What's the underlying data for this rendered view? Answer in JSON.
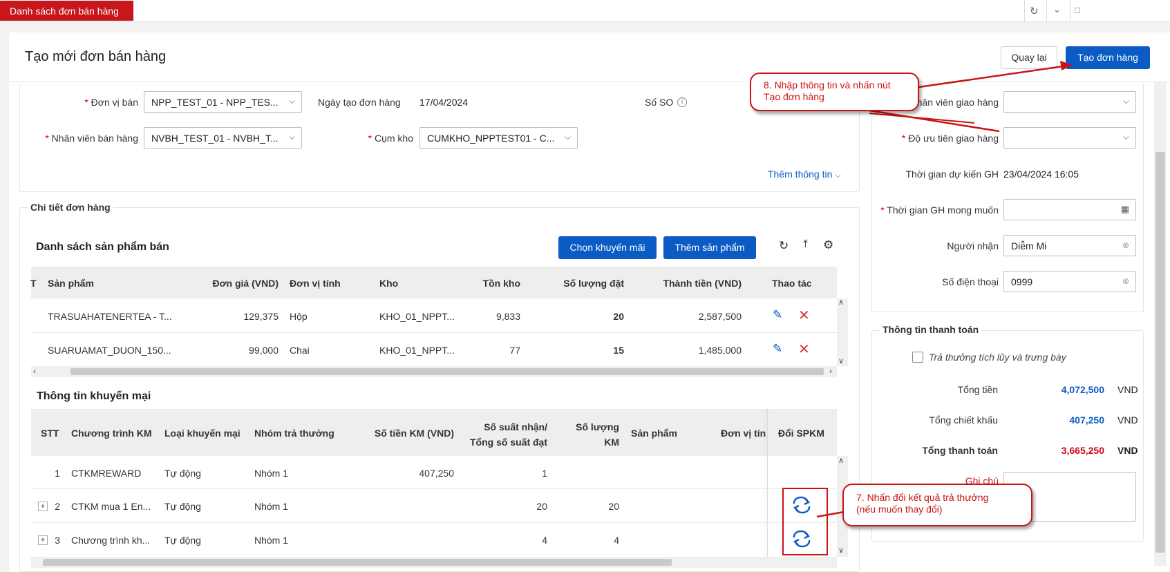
{
  "app": {
    "active_tab": "Danh sách đơn bán hàng"
  },
  "header": {
    "title": "Tạo mới đơn bán hàng",
    "back_label": "Quay lại",
    "create_label": "Tạo đơn hàng"
  },
  "form": {
    "don_vi_ban": {
      "label": "Đơn vị bán",
      "value": "NPP_TEST_01 - NPP_TES..."
    },
    "ngay_tao": {
      "label": "Ngày tạo đơn hàng",
      "value": "17/04/2024"
    },
    "so_so": {
      "label": "Số SO"
    },
    "nhan_vien_ban": {
      "label": "Nhân viên bán hàng",
      "value": "NVBH_TEST_01 - NVBH_T..."
    },
    "cum_kho": {
      "label": "Cụm kho",
      "value": "CUMKHO_NPPTEST01 - C..."
    },
    "them_thong_tin": "Thêm thông tin",
    "req_mark": "*"
  },
  "right_panel": {
    "nv_giao_hang_label": "hân viên giao hàng",
    "do_uu_tien_label": "Độ ưu tiên giao hàng",
    "thoi_gian_du_kien_label": "Thời gian dự kiến GH",
    "thoi_gian_du_kien_value": "23/04/2024 16:05",
    "thoi_gian_mong_muon_label": "Thời gian GH mong muốn",
    "nguoi_nhan_label": "Người nhận",
    "nguoi_nhan_value": "Diễm Mi",
    "sdt_label": "Số điện thoại",
    "sdt_value": "0999"
  },
  "payment": {
    "title": "Thông tin thanh toán",
    "checkbox_label": "Trả thưởng tích lũy và trưng bày",
    "tong_tien_label": "Tổng tiền",
    "tong_tien_value": "4,072,500",
    "tong_ck_label": "Tổng chiết khấu",
    "tong_ck_value": "407,250",
    "tong_tt_label": "Tổng thanh toán",
    "tong_tt_value": "3,665,250",
    "currency": "VND",
    "ghi_chu_label": "Ghi chú"
  },
  "order_detail": {
    "section_title": "Chi tiết đơn hàng",
    "list_title": "Danh sách sản phẩm bán",
    "btn_km": "Chọn khuyến mãi",
    "btn_add": "Thêm sản phẩm",
    "columns": {
      "stt": "T",
      "san_pham": "Sản phẩm",
      "don_gia": "Đơn giá (VND)",
      "dvt": "Đơn vị tính",
      "kho": "Kho",
      "ton_kho": "Tồn kho",
      "sl_dat": "Số lượng đặt",
      "thanh_tien": "Thành tiền (VND)",
      "thao_tac": "Thao tác"
    },
    "rows": [
      {
        "san_pham": "TRASUAHATENERTEA - T...",
        "don_gia": "129,375",
        "dvt": "Hộp",
        "kho": "KHO_01_NPPT...",
        "ton_kho": "9,833",
        "sl_dat": "20",
        "thanh_tien": "2,587,500"
      },
      {
        "san_pham": "SUARUAMAT_DUON_150...",
        "don_gia": "99,000",
        "dvt": "Chai",
        "kho": "KHO_01_NPPT...",
        "ton_kho": "77",
        "sl_dat": "15",
        "thanh_tien": "1,485,000"
      }
    ]
  },
  "promotion": {
    "title": "Thông tin khuyến mại",
    "columns": {
      "stt": "STT",
      "ctkm": "Chương trình KM",
      "loai": "Loại khuyến mại",
      "nhom": "Nhóm trả thưởng",
      "so_tien": "Số tiền KM (VND)",
      "so_suat_1": "Số suất nhận/",
      "so_suat_2": "Tổng số suất đạt",
      "sl_km_1": "Số lượng",
      "sl_km_2": "KM",
      "san_pham": "Sản phẩm",
      "dvt": "Đơn vị tín",
      "doi": "Đổi SPKM"
    },
    "rows": [
      {
        "stt": "1",
        "ctkm": "CTKMREWARD",
        "loai": "Tự động",
        "nhom": "Nhóm 1",
        "so_tien": "407,250",
        "so_suat": "1",
        "sl_km": ""
      },
      {
        "stt": "2",
        "ctkm": "CTKM mua 1 En...",
        "loai": "Tự động",
        "nhom": "Nhóm 1",
        "so_tien": "",
        "so_suat": "20",
        "sl_km": "20"
      },
      {
        "stt": "3",
        "ctkm": "Chương trình kh...",
        "loai": "Tự động",
        "nhom": "Nhóm 1",
        "so_tien": "",
        "so_suat": "4",
        "sl_km": "4"
      }
    ]
  },
  "callouts": {
    "c8_line1": "8. Nhập thông tin và nhấn nút",
    "c8_line2": "Tạo đơn hàng",
    "c7_line1": "7. Nhấn đổi kết quả trả thưởng",
    "c7_line2": "(nếu muốn thay đổi)"
  },
  "colors": {
    "brand_red": "#c8161d",
    "primary_blue": "#0a5bc4",
    "annotation_red": "#c81414",
    "total_red": "#d0021b"
  }
}
